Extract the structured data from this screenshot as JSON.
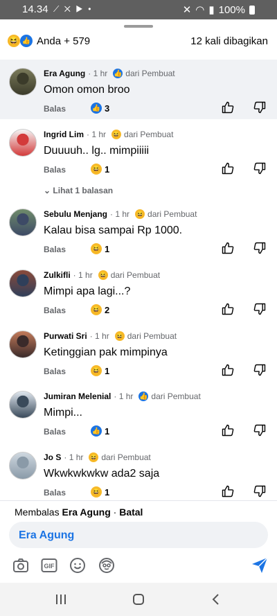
{
  "status": {
    "time": "14.34",
    "battery": "100%"
  },
  "reactions": {
    "summary": "Anda + 579",
    "shares": "12 kali dibagikan"
  },
  "comments": [
    {
      "name": "Era Agung",
      "time": "1 hr",
      "badge": "like",
      "by": "dari Pembuat",
      "text": "Omon omon broo",
      "reply": "Balas",
      "count": "3",
      "count_badge": "like"
    },
    {
      "name": "Ingrid Lim",
      "time": "1 hr",
      "badge": "haha",
      "by": "dari Pembuat",
      "text": "Duuuuh.. lg.. mimpiiiii",
      "reply": "Balas",
      "count": "1",
      "count_badge": "haha",
      "more": "Lihat 1 balasan"
    },
    {
      "name": "Sebulu Menjang",
      "time": "1 hr",
      "badge": "haha",
      "by": "dari Pembuat",
      "text": "Kalau bisa sampai Rp 1000.",
      "reply": "Balas",
      "count": "1",
      "count_badge": "haha"
    },
    {
      "name": "Zulkifli",
      "time": "1 hr",
      "badge": "haha",
      "by": "dari Pembuat",
      "text": "Mimpi apa lagi...?",
      "reply": "Balas",
      "count": "2",
      "count_badge": "haha"
    },
    {
      "name": "Purwati Sri",
      "time": "1 hr",
      "badge": "haha",
      "by": "dari Pembuat",
      "text": "Ketinggian pak mimpinya",
      "reply": "Balas",
      "count": "1",
      "count_badge": "haha"
    },
    {
      "name": "Jumiran Melenial",
      "time": "1 hr",
      "badge": "like",
      "by": "dari Pembuat",
      "text": "Mimpi...",
      "reply": "Balas",
      "count": "1",
      "count_badge": "like"
    },
    {
      "name": "Jo S",
      "time": "1 hr",
      "badge": "haha",
      "by": "dari Pembuat",
      "text": "Wkwkwkwkw ada2 saja",
      "reply": "Balas",
      "count": "1",
      "count_badge": "haha"
    }
  ],
  "composer": {
    "replying_prefix": "Membalas",
    "replying_to": "Era Agung",
    "cancel": "Batal",
    "input_value": "Era Agung"
  },
  "colors": {
    "accent": "#1b74e4",
    "haha": "#f7b928",
    "highlight": "#f0f2f5"
  }
}
